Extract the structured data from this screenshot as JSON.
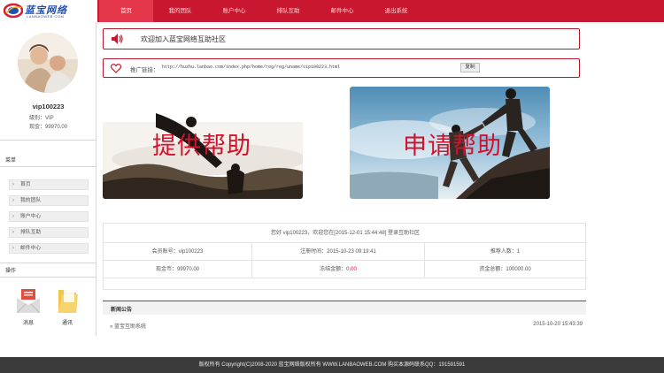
{
  "logo": {
    "text": "蓝宝网络",
    "sub": "LANBAOWEB.COM"
  },
  "nav": [
    {
      "label": "首页"
    },
    {
      "label": "我的团队"
    },
    {
      "label": "账户中心"
    },
    {
      "label": "排队互助"
    },
    {
      "label": "邮件中心"
    },
    {
      "label": "退出系统"
    }
  ],
  "user": {
    "name": "vip100223",
    "level": "级别：VIP",
    "funds": "现金：99970.00"
  },
  "sidebar": {
    "menu_title": "菜单",
    "menu": [
      {
        "label": "首页"
      },
      {
        "label": "我的团队"
      },
      {
        "label": "账户中心"
      },
      {
        "label": "排队互助"
      },
      {
        "label": "邮件中心"
      }
    ],
    "ops_title": "操作",
    "tools": [
      {
        "label": "消息"
      },
      {
        "label": "通讯"
      }
    ]
  },
  "welcome": {
    "message": "欢迎加入蓝宝网络互助社区"
  },
  "promo": {
    "label": "推广链接：",
    "url": "http://huzhu.lanbao.com/index.php/home/reg/reg/uname/vip100223.html",
    "copy_label": "复制"
  },
  "banners": {
    "provide": "提供帮助",
    "request": "申请帮助"
  },
  "account": {
    "greeting": "您好 vip100223，欢迎您在[2015-12-01 15:44:48] 登录互助社区",
    "rows": [
      [
        "会员账号：vip100223",
        "注册时间：2015-10-23 09:19:41",
        "推荐人数：1"
      ],
      [
        "现金币：99970.00",
        "冻结金额：",
        "资金总额：100000.00"
      ]
    ],
    "frozen_value": "0.00"
  },
  "news": {
    "title": "新闻公告",
    "items": [
      {
        "title": "» 蓝宝互助系统",
        "date": "2015-10-20 15:43:39"
      }
    ]
  },
  "footer": {
    "text": "版权所有 Copyright(C)2008-2020 蓝宝网络版权所有 WWW.LANBAOWEB.COM 购买本源码联系QQ：191591591"
  },
  "colors": {
    "brand": "#c8172e",
    "nav_active": "#e4374c",
    "footer_bg": "#3b3b3b"
  }
}
